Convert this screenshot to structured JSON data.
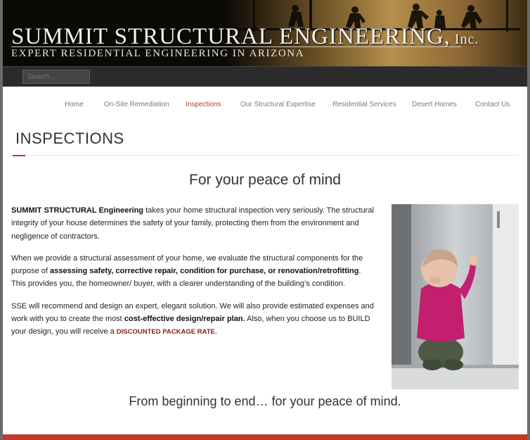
{
  "header": {
    "title_main": "SUMMIT STRUCTURAL ENGINEERING,",
    "title_suffix": "Inc.",
    "tagline": "EXPERT RESIDENTIAL ENGINEERING IN ARIZONA"
  },
  "search": {
    "placeholder": "Search ..."
  },
  "nav": {
    "items": [
      {
        "label": "Home"
      },
      {
        "label": "On-Site Remediation"
      },
      {
        "label": "Inspections"
      },
      {
        "label": "Our Structural Expertise"
      },
      {
        "label": "Residential Services"
      },
      {
        "label": "Desert Homes"
      },
      {
        "label": "Contact Us"
      }
    ],
    "active_index": 2
  },
  "page": {
    "title": "INSPECTIONS",
    "headline": "For your peace of mind",
    "p1_bold": "SUMMIT STRUCTURAL Engineering",
    "p1_rest": " takes your home structural inspection very seriously.  The structural integrity of your house determines the safety of your family, protecting them from the environment and negligence of contractors.",
    "p2_a": "When we provide a structural assessment of your home, we evaluate the structural components for the purpose of ",
    "p2_bold": "assessing safety, corrective repair, condition for purchase, or renovation/retrofitting",
    "p2_b": ".  This provides you, the homeowner/ buyer, with a clearer understanding of the building’s condition.",
    "p3_a": "SSE will recommend and design an expert, elegant solution. We will also provide estimated expenses and work with you to create the most ",
    "p3_bold": "cost-effective design/repair plan.",
    "p3_b": " Also, when you choose us to BUILD your design, you will receive a ",
    "p3_discount": "DISCOUNTED PACKAGE RATE",
    "p3_end": ".",
    "footer_line": "From beginning to end… for your peace of mind."
  },
  "colors": {
    "accent": "#c0392b",
    "header_bg": "#0b0906",
    "search_bar_bg": "#2b2b2b"
  }
}
